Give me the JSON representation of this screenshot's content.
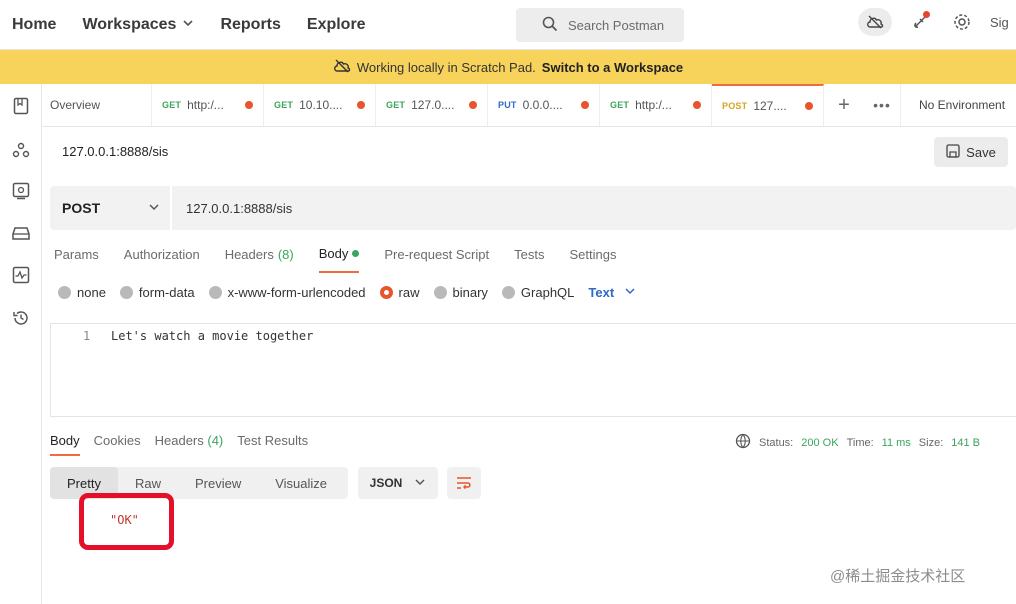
{
  "nav": {
    "items": [
      "Home",
      "Workspaces",
      "Reports",
      "Explore"
    ],
    "search_placeholder": "Search Postman",
    "sign": "Sig"
  },
  "banner": {
    "text": "Working locally in Scratch Pad.",
    "link": "Switch to a Workspace"
  },
  "tabs": {
    "overview": "Overview",
    "items": [
      {
        "method": "GET",
        "label": "http:/..."
      },
      {
        "method": "GET",
        "label": "10.10...."
      },
      {
        "method": "GET",
        "label": "127.0...."
      },
      {
        "method": "PUT",
        "label": "0.0.0...."
      },
      {
        "method": "GET",
        "label": "http:/..."
      },
      {
        "method": "POST",
        "label": "127...."
      }
    ],
    "plus": "+",
    "more": "•••",
    "environment": "No Environment"
  },
  "request": {
    "title": "127.0.0.1:8888/sis",
    "save_label": "Save",
    "method": "POST",
    "url": "127.0.0.1:8888/sis",
    "subtabs": {
      "params": "Params",
      "authorization": "Authorization",
      "headers": "Headers",
      "headers_count": "(8)",
      "body": "Body",
      "prerequest": "Pre-request Script",
      "tests": "Tests",
      "settings": "Settings"
    },
    "body_types": {
      "none": "none",
      "form_data": "form-data",
      "urlencoded": "x-www-form-urlencoded",
      "raw": "raw",
      "binary": "binary",
      "graphql": "GraphQL",
      "format": "Text"
    },
    "editor": {
      "line_number": "1",
      "code": "Let's watch a movie together"
    }
  },
  "response": {
    "tabs": {
      "body": "Body",
      "cookies": "Cookies",
      "headers": "Headers",
      "headers_count": "(4)",
      "test_results": "Test Results"
    },
    "status_label": "Status:",
    "status_value": "200 OK",
    "time_label": "Time:",
    "time_value": "11 ms",
    "size_label": "Size:",
    "size_value": "141 B",
    "views": {
      "pretty": "Pretty",
      "raw": "Raw",
      "preview": "Preview",
      "visualize": "Visualize"
    },
    "format": "JSON",
    "body_text": "\"OK\""
  },
  "watermark": "@稀土掘金技术社区",
  "colors": {
    "accent": "#f26b3a",
    "banner": "#f7d35c",
    "highlight": "#e4102a",
    "ok_green": "#3aa55d"
  }
}
